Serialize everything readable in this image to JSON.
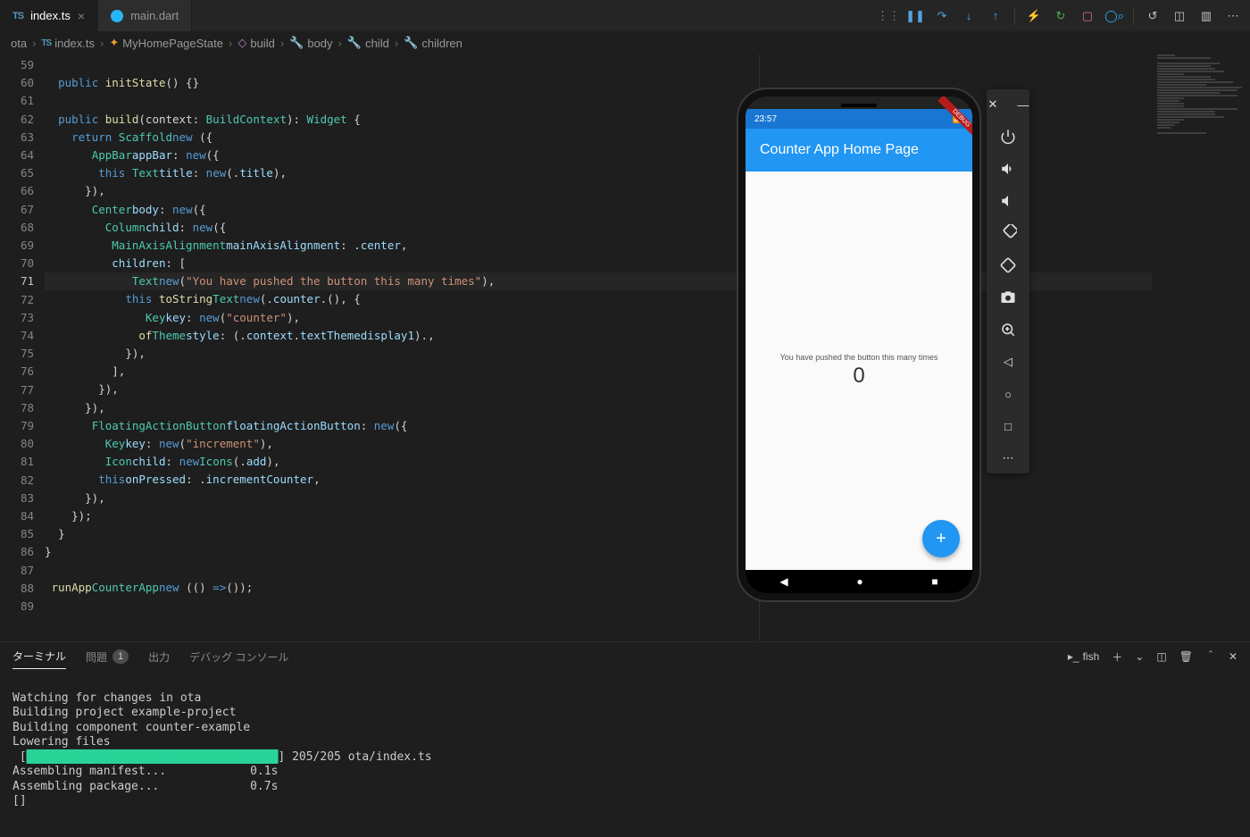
{
  "tabs": [
    {
      "label": "index.ts",
      "icon": "TS",
      "active": true
    },
    {
      "label": "main.dart",
      "icon": "dart",
      "active": false
    }
  ],
  "breadcrumb": [
    {
      "label": "ota",
      "icon": ""
    },
    {
      "label": "index.ts",
      "icon": "TS"
    },
    {
      "label": "MyHomePageState",
      "icon": "class"
    },
    {
      "label": "build",
      "icon": "method"
    },
    {
      "label": "body",
      "icon": "prop"
    },
    {
      "label": "child",
      "icon": "prop"
    },
    {
      "label": "children",
      "icon": "prop"
    }
  ],
  "gutter": {
    "start": 59,
    "end": 89,
    "current": 71
  },
  "code": {
    "l59": "",
    "l60": {
      "pre": "  ",
      "kw": "public",
      "sp": " ",
      "fn": "initState",
      "rest": "() {}"
    },
    "l61": "",
    "l62": {
      "pre": "  ",
      "kw": "public",
      "sp": " ",
      "fn": "build",
      "sig": "(context: ",
      "type": "BuildContext",
      "sig2": "): ",
      "ret": "Widget",
      "brace": " {"
    },
    "l63": {
      "pre": "    ",
      "kw": "return",
      "sp": " ",
      "nw": "new",
      "sp2": " ",
      "type": "Scaffold",
      "rest": "({"
    },
    "l64": {
      "pre": "      ",
      "prop": "appBar",
      "colon": ": ",
      "nw": "new",
      "sp": " ",
      "type": "AppBar",
      "rest": "({"
    },
    "l65": {
      "pre": "        ",
      "prop": "title",
      "colon": ": ",
      "nw": "new",
      "sp": " ",
      "type": "Text",
      "op": "(",
      "kw": "this",
      "dot": ".",
      "id": "title",
      "rest": "),"
    },
    "l66": {
      "pre": "      ",
      "rest": "}),"
    },
    "l67": {
      "pre": "      ",
      "prop": "body",
      "colon": ": ",
      "nw": "new",
      "sp": " ",
      "type": "Center",
      "rest": "({"
    },
    "l68": {
      "pre": "        ",
      "prop": "child",
      "colon": ": ",
      "nw": "new",
      "sp": " ",
      "type": "Column",
      "rest": "({"
    },
    "l69": {
      "pre": "          ",
      "prop": "mainAxisAlignment",
      "colon": ": ",
      "type": "MainAxisAlignment",
      "dot": ".",
      "id": "center",
      "rest": ","
    },
    "l70": {
      "pre": "          ",
      "prop": "children",
      "colon": ": ",
      "rest": "["
    },
    "l71": {
      "pre": "            ",
      "nw": "new",
      "sp": " ",
      "type": "Text",
      "op": "(",
      "str": "\"You have pushed the button this many times\"",
      "rest": "),"
    },
    "l72": {
      "pre": "            ",
      "nw": "new",
      "sp": " ",
      "type": "Text",
      "op": "(",
      "kw": "this",
      "dot": ".",
      "id": "counter",
      "dot2": ".",
      "fn": "toString",
      "rest": "(), {"
    },
    "l73": {
      "pre": "              ",
      "prop": "key",
      "colon": ": ",
      "nw": "new",
      "sp": " ",
      "type": "Key",
      "op": "(",
      "str": "\"counter\"",
      "rest": "),"
    },
    "l74": {
      "pre": "              ",
      "prop": "style",
      "colon": ": ",
      "type": "Theme",
      "dot": ".",
      "fn": "of",
      "op": "(",
      "id": "context",
      "cp": ").",
      "id2": "textTheme",
      "dot2": ".",
      "id3": "display1",
      "rest": ","
    },
    "l75": {
      "pre": "            ",
      "rest": "}),"
    },
    "l76": {
      "pre": "          ",
      "rest": "],"
    },
    "l77": {
      "pre": "        ",
      "rest": "}),"
    },
    "l78": {
      "pre": "      ",
      "rest": "}),"
    },
    "l79": {
      "pre": "      ",
      "prop": "floatingActionButton",
      "colon": ": ",
      "nw": "new",
      "sp": " ",
      "type": "FloatingActionButton",
      "rest": "({"
    },
    "l80": {
      "pre": "        ",
      "prop": "key",
      "colon": ": ",
      "nw": "new",
      "sp": " ",
      "type": "Key",
      "op": "(",
      "str": "\"increment\"",
      "rest": "),"
    },
    "l81": {
      "pre": "        ",
      "prop": "child",
      "colon": ": ",
      "nw": "new",
      "sp": " ",
      "type": "Icon",
      "op": "(",
      "type2": "Icons",
      "dot": ".",
      "id": "add",
      "rest": "),"
    },
    "l82": {
      "pre": "        ",
      "prop": "onPressed",
      "colon": ": ",
      "kw": "this",
      "dot": ".",
      "id": "incrementCounter",
      "rest": ","
    },
    "l83": {
      "pre": "      ",
      "rest": "}),"
    },
    "l84": {
      "pre": "    ",
      "rest": "});"
    },
    "l85": {
      "pre": "  ",
      "rest": "}"
    },
    "l86": {
      "pre": "",
      "rest": "}"
    },
    "l87": "",
    "l88": {
      "pre": "",
      "fn": "runApp",
      "op": "(() ",
      "arrow": "=>",
      "sp": " ",
      "nw": "new",
      "sp2": " ",
      "type": "CounterApp",
      "rest": "());"
    },
    "l89": ""
  },
  "panel": {
    "tabs": {
      "terminal": "ターミナル",
      "problems": "問題",
      "problems_count": "1",
      "output": "出力",
      "debug": "デバッグ コンソール"
    },
    "shell_label": "fish"
  },
  "terminal": {
    "l1": "Watching for changes in ota",
    "l2": "Building project example-project",
    "l3": "Building component counter-example",
    "l4": "Lowering files",
    "l5_open": " [",
    "l5_bar": "████████████████████████████████████",
    "l5_close": "] 205/205 ota/index.ts",
    "l6": "Assembling manifest...            0.1s",
    "l7": "Assembling package...             0.7s",
    "l8": "[]"
  },
  "emulator": {
    "status_time": "23:57",
    "app_title": "Counter App Home Page",
    "body_text": "You have pushed the button this many times",
    "counter": "0",
    "fab": "+"
  },
  "debug_toolbar": {
    "icons": [
      "drag",
      "pause",
      "step-over",
      "step-into",
      "step-out",
      "hot-reload",
      "restart",
      "stop",
      "devtools"
    ]
  }
}
